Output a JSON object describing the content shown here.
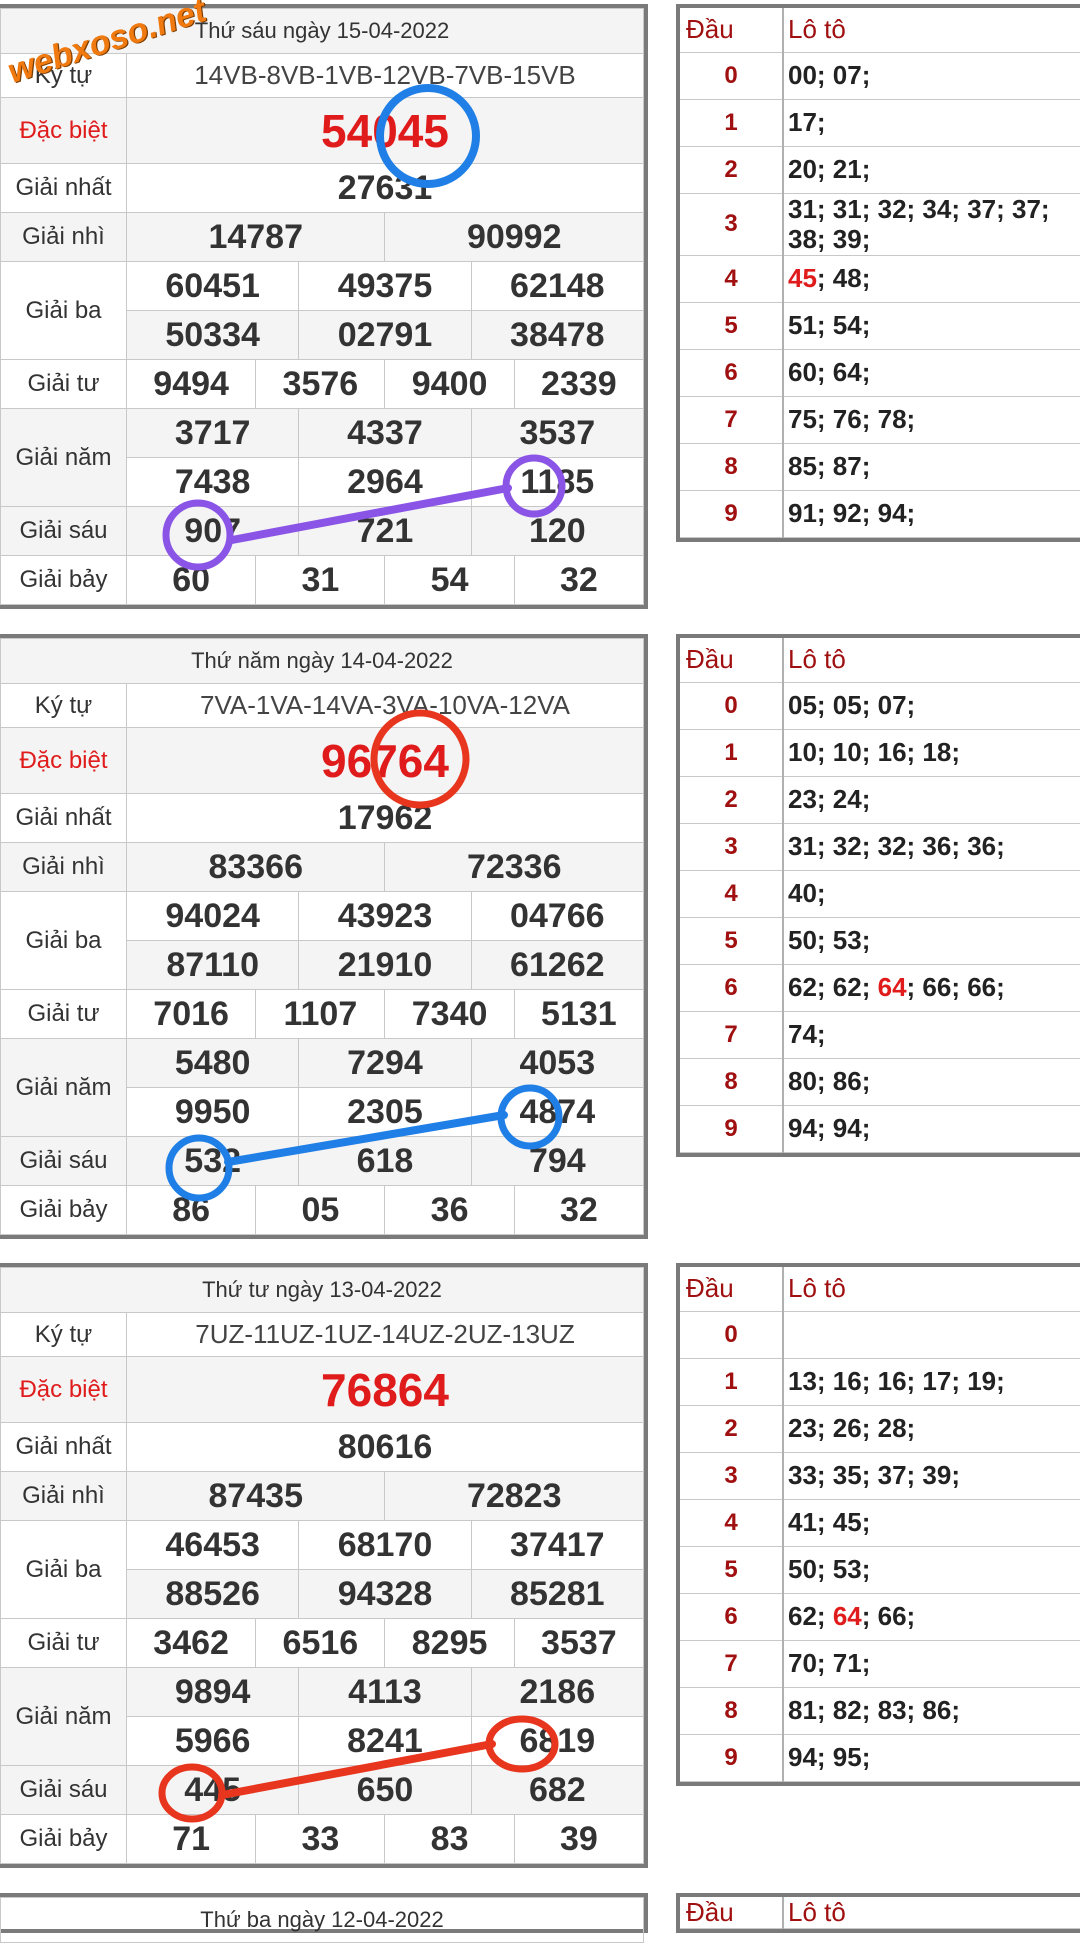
{
  "watermark": "webxoso.net",
  "labels": {
    "code": "Ký tự",
    "special": "Đặc biệt",
    "first": "Giải nhất",
    "second": "Giải nhì",
    "third": "Giải ba",
    "fourth": "Giải tư",
    "fifth": "Giải năm",
    "sixth": "Giải sáu",
    "seventh": "Giải bảy",
    "loto_head": "Đầu",
    "loto_col": "Lô tô"
  },
  "draws": [
    {
      "title": "Thứ sáu ngày 15-04-2022",
      "code": "14VB-8VB-1VB-12VB-7VB-15VB",
      "special": "54045",
      "first": "27631",
      "second": [
        "14787",
        "90992"
      ],
      "third": [
        "60451",
        "49375",
        "62148",
        "50334",
        "02791",
        "38478"
      ],
      "fourth": [
        "9494",
        "3576",
        "9400",
        "2339"
      ],
      "fifth": [
        "3717",
        "4337",
        "3537",
        "7438",
        "2964",
        "1185"
      ],
      "sixth": [
        "907",
        "721",
        "120"
      ],
      "seventh": [
        "60",
        "31",
        "54",
        "32"
      ],
      "loto": [
        {
          "d": "0",
          "v": "00; 07;"
        },
        {
          "d": "1",
          "v": "17;"
        },
        {
          "d": "2",
          "v": "20; 21;"
        },
        {
          "d": "3",
          "v": "31; 31; 32; 34; 37; 37; 38; 39;"
        },
        {
          "d": "4",
          "pre": "",
          "hl": "45",
          "post": "; 48;"
        },
        {
          "d": "5",
          "v": "51; 54;"
        },
        {
          "d": "6",
          "v": "60; 64;"
        },
        {
          "d": "7",
          "v": "75; 76; 78;"
        },
        {
          "d": "8",
          "v": "85; 87;"
        },
        {
          "d": "9",
          "v": "91; 92; 94;"
        }
      ]
    },
    {
      "title": "Thứ năm ngày 14-04-2022",
      "code": "7VA-1VA-14VA-3VA-10VA-12VA",
      "special": "96764",
      "first": "17962",
      "second": [
        "83366",
        "72336"
      ],
      "third": [
        "94024",
        "43923",
        "04766",
        "87110",
        "21910",
        "61262"
      ],
      "fourth": [
        "7016",
        "1107",
        "7340",
        "5131"
      ],
      "fifth": [
        "5480",
        "7294",
        "4053",
        "9950",
        "2305",
        "4874"
      ],
      "sixth": [
        "532",
        "618",
        "794"
      ],
      "seventh": [
        "86",
        "05",
        "36",
        "32"
      ],
      "loto": [
        {
          "d": "0",
          "v": "05; 05; 07;"
        },
        {
          "d": "1",
          "v": "10; 10; 16; 18;"
        },
        {
          "d": "2",
          "v": "23; 24;"
        },
        {
          "d": "3",
          "v": "31; 32; 32; 36; 36;"
        },
        {
          "d": "4",
          "v": "40;"
        },
        {
          "d": "5",
          "v": "50; 53;"
        },
        {
          "d": "6",
          "pre": "62; 62; ",
          "hl": "64",
          "post": "; 66; 66;"
        },
        {
          "d": "7",
          "v": "74;"
        },
        {
          "d": "8",
          "v": "80; 86;"
        },
        {
          "d": "9",
          "v": "94; 94;"
        }
      ]
    },
    {
      "title": "Thứ tư ngày 13-04-2022",
      "code": "7UZ-11UZ-1UZ-14UZ-2UZ-13UZ",
      "special": "76864",
      "first": "80616",
      "second": [
        "87435",
        "72823"
      ],
      "third": [
        "46453",
        "68170",
        "37417",
        "88526",
        "94328",
        "85281"
      ],
      "fourth": [
        "3462",
        "6516",
        "8295",
        "3537"
      ],
      "fifth": [
        "9894",
        "4113",
        "2186",
        "5966",
        "8241",
        "6819"
      ],
      "sixth": [
        "445",
        "650",
        "682"
      ],
      "seventh": [
        "71",
        "33",
        "83",
        "39"
      ],
      "loto": [
        {
          "d": "0",
          "v": ""
        },
        {
          "d": "1",
          "v": "13; 16; 16; 17; 19;"
        },
        {
          "d": "2",
          "v": "23; 26; 28;"
        },
        {
          "d": "3",
          "v": "33; 35; 37; 39;"
        },
        {
          "d": "4",
          "v": "41; 45;"
        },
        {
          "d": "5",
          "v": "50; 53;"
        },
        {
          "d": "6",
          "pre": "62; ",
          "hl": "64",
          "post": "; 66;"
        },
        {
          "d": "7",
          "v": "70; 71;"
        },
        {
          "d": "8",
          "v": "81; 82; 83; 86;"
        },
        {
          "d": "9",
          "v": "94; 95;"
        }
      ]
    }
  ],
  "partial": {
    "title": "Thứ ba ngày 12-04-2022",
    "loto_head": "Đầu",
    "loto_col": "Lô tô"
  },
  "colors": {
    "special": "#e01b1b",
    "circle1": "#1f7fe6",
    "circle1_line": "#8a55e6",
    "circle2": "#e8351e",
    "circle3": "#e8351e",
    "line2": "#1f7fe6",
    "line3": "#e8351e"
  }
}
